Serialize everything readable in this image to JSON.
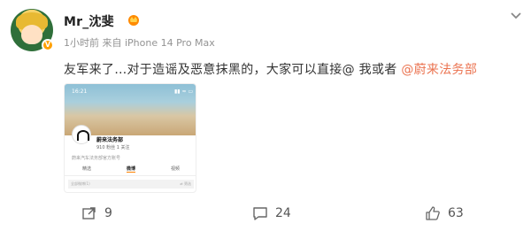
{
  "post": {
    "author": "Mr_沈斐",
    "meta": "1小时前 来自 iPhone 14 Pro Max",
    "text": "友军来了…对于造谣及恶意抹黑的，大家可以直接@ 我或者",
    "mention": "@蔚来法务部"
  },
  "embedded_screenshot": {
    "status_time": "16:21",
    "status_right": "▮▮ ≈ ▭",
    "account_name": "蔚来法务部",
    "stats": "910 粉丝   1 关注",
    "description": "蔚来汽车法务部官方账号",
    "tabs": [
      "精选",
      "微博",
      "视频"
    ],
    "active_tab": "微博",
    "row_left": "全部微博(1)",
    "row_right": "⇄ 筛选"
  },
  "actions": {
    "reposts": "9",
    "comments": "24",
    "likes": "63"
  },
  "colors": {
    "mention": "#eb7350",
    "vip_badge": "#ffa000",
    "meta": "#939393"
  },
  "icons": [
    "vip-crown-icon",
    "chevron-down-icon",
    "repost-icon",
    "comment-icon",
    "like-icon"
  ]
}
